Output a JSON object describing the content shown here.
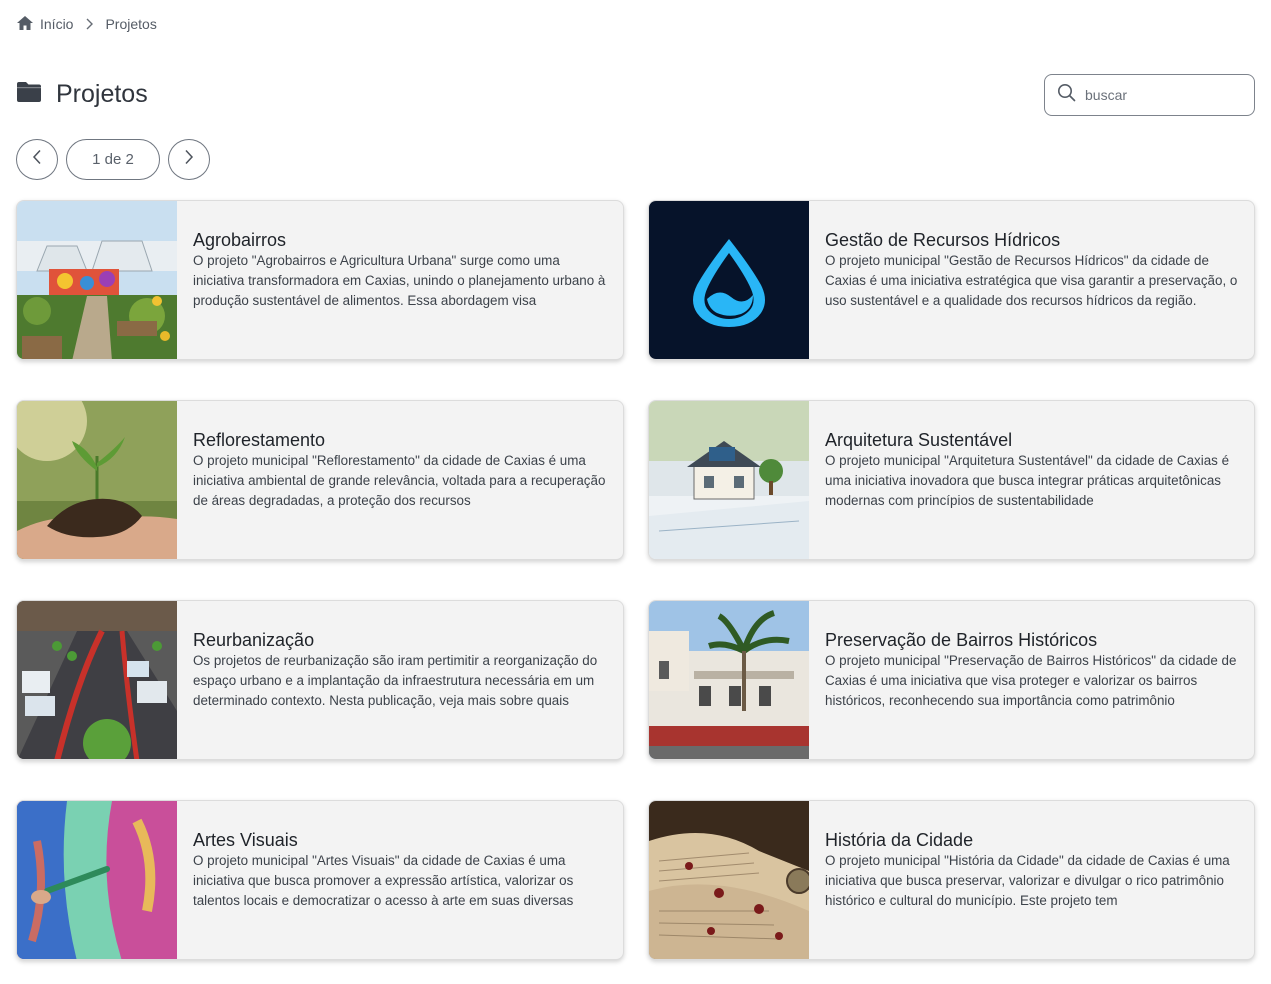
{
  "breadcrumb": {
    "home_icon": "home-icon",
    "home_label": "Início",
    "separator_icon": "chevron-right-icon",
    "current_label": "Projetos"
  },
  "header": {
    "icon": "folder-icon",
    "title": "Projetos"
  },
  "search": {
    "icon": "search-icon",
    "placeholder": "buscar",
    "value": ""
  },
  "pagination": {
    "prev_icon": "chevron-left-icon",
    "next_icon": "chevron-right-icon",
    "indicator": "1 de 2"
  },
  "colors": {
    "card_bg": "#f3f3f3",
    "water_icon": "#29b6f6",
    "water_bg": "#06132a"
  },
  "projects": [
    {
      "title": "Agrobairros",
      "description": "O projeto \"Agrobairros e Agricultura Urbana\" surge como uma iniciativa transformadora em Caxias, unindo o planejamento urbano à produção sustentável de alimentos. Essa abordagem visa",
      "image": "greenhouse-garden-photo"
    },
    {
      "title": "Gestão de Recursos Hídricos",
      "description": "O projeto municipal \"Gestão de Recursos Hídricos\" da cidade de Caxias é uma iniciativa estratégica que visa garantir a preservação, o uso sustentável e a qualidade dos recursos hídricos da região.",
      "image": "water-drop-logo"
    },
    {
      "title": "Reflorestamento",
      "description": "O projeto municipal \"Reflorestamento\" da cidade de Caxias é uma iniciativa ambiental de grande relevância, voltada para a recuperação de áreas degradadas, a proteção dos recursos",
      "image": "hands-seedling-photo"
    },
    {
      "title": "Arquitetura Sustentável",
      "description": "O projeto municipal \"Arquitetura Sustentável\" da cidade de Caxias é uma iniciativa inovadora que busca integrar práticas arquitetônicas modernas com princípios de sustentabilidade",
      "image": "house-model-photo"
    },
    {
      "title": "Reurbanização",
      "description": "Os projetos de reurbanização são iram pertimitir a reorganização do espaço urbano e a implantação da infraestrutura necessária em um determinado contexto. Nesta publicação, veja mais sobre quais",
      "image": "urban-model-photo"
    },
    {
      "title": "Preservação de Bairros Históricos",
      "description": "O projeto municipal \"Preservação de Bairros Históricos\" da cidade de Caxias é uma iniciativa que visa proteger e valorizar os bairros históricos, reconhecendo sua importância como patrimônio",
      "image": "historic-building-photo"
    },
    {
      "title": "Artes Visuais",
      "description": "O projeto municipal \"Artes Visuais\" da cidade de Caxias é uma iniciativa que busca promover a expressão artística, valorizar os talentos locais e democratizar o acesso à arte em suas diversas",
      "image": "painting-brush-photo"
    },
    {
      "title": "História da Cidade",
      "description": "O projeto municipal \"História da Cidade\" da cidade de Caxias é uma iniciativa que busca preservar, valorizar e divulgar o rico patrimônio histórico e cultural do município. Este projeto tem",
      "image": "old-book-photo"
    }
  ]
}
